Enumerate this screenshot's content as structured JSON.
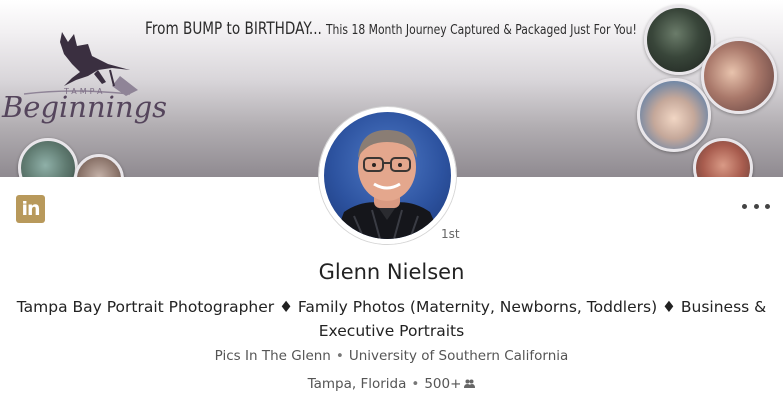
{
  "banner": {
    "tagline_big": "From BUMP to BIRTHDAY...",
    "tagline_small": "This 18 Month Journey Captured & Packaged Just For You!",
    "brand_small": "TAMPA",
    "brand_main": "Beginnings"
  },
  "profile": {
    "network_badge": "in",
    "degree": "1st",
    "name": "Glenn Nielsen",
    "headline": "Tampa Bay Portrait Photographer ♦ Family Photos (Maternity, Newborns, Toddlers) ♦ Business & Executive Portraits",
    "company": "Pics In The Glenn",
    "school": "University of Southern California",
    "separator": "•",
    "location": "Tampa, Florida",
    "connections": "500+"
  },
  "icons": {
    "logo": "linkedin-icon",
    "more": "more-options-icon",
    "connections": "people-icon"
  },
  "colors": {
    "linkedin_badge": "#b8995b",
    "brand_purple": "#55455c",
    "avatar_background": "#2d53a0"
  }
}
